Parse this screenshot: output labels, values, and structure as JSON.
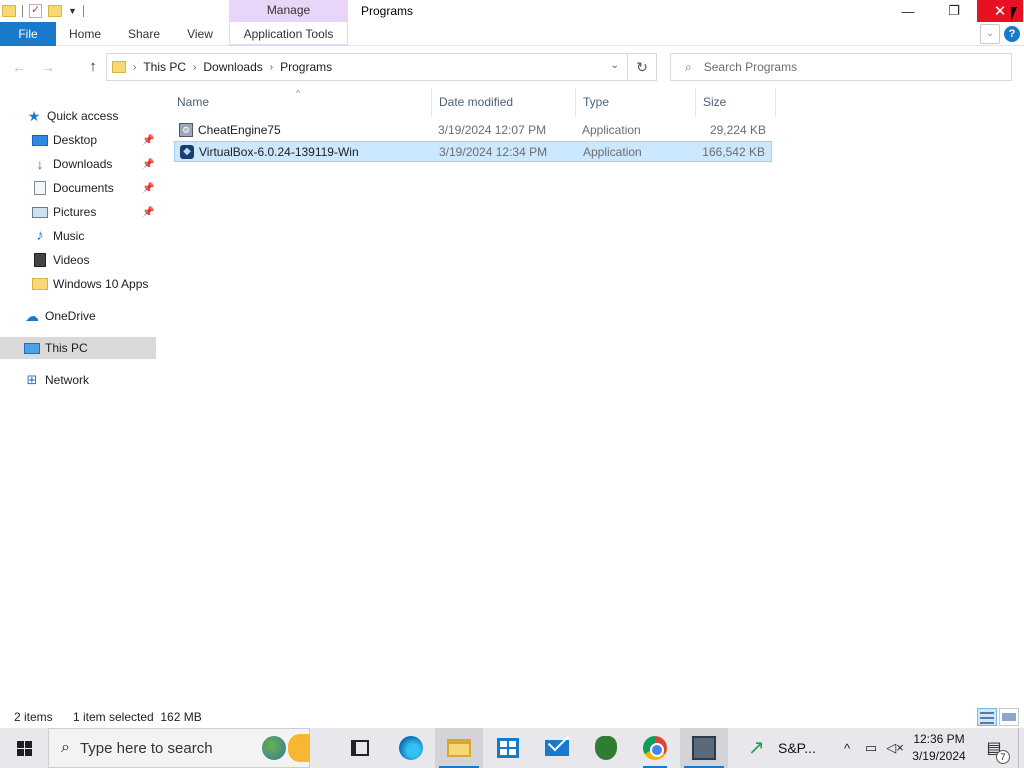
{
  "titlebar": {
    "manage_label": "Manage",
    "window_title": "Programs",
    "minimize_glyph": "—",
    "restore_glyph": "❐",
    "close_glyph": "✕"
  },
  "ribbon": {
    "tabs": [
      {
        "label": "File"
      },
      {
        "label": "Home"
      },
      {
        "label": "Share"
      },
      {
        "label": "View"
      },
      {
        "label": "Application Tools"
      }
    ],
    "help_glyph": "?"
  },
  "address": {
    "crumbs": [
      "This PC",
      "Downloads",
      "Programs"
    ],
    "search_placeholder": "Search Programs"
  },
  "nav_pane": {
    "items": [
      {
        "label": "Quick access",
        "icon": "star-icon"
      },
      {
        "label": "Desktop",
        "icon": "desktop-icon",
        "pinned": true
      },
      {
        "label": "Downloads",
        "icon": "download-icon",
        "pinned": true
      },
      {
        "label": "Documents",
        "icon": "document-icon",
        "pinned": true
      },
      {
        "label": "Pictures",
        "icon": "pictures-icon",
        "pinned": true
      },
      {
        "label": "Music",
        "icon": "music-icon"
      },
      {
        "label": "Videos",
        "icon": "videos-icon"
      },
      {
        "label": "Windows 10 Apps",
        "icon": "folder-icon"
      },
      {
        "label": "OneDrive",
        "icon": "cloud-icon"
      },
      {
        "label": "This PC",
        "icon": "computer-icon",
        "selected": true
      },
      {
        "label": "Network",
        "icon": "network-icon"
      }
    ]
  },
  "files": {
    "columns": [
      "Name",
      "Date modified",
      "Type",
      "Size"
    ],
    "rows": [
      {
        "name": "CheatEngine75",
        "date": "3/19/2024 12:07 PM",
        "type": "Application",
        "size": "29,224 KB",
        "icon": "cheatengine-icon",
        "selected": false
      },
      {
        "name": "VirtualBox-6.0.24-139119-Win",
        "date": "3/19/2024 12:34 PM",
        "type": "Application",
        "size": "166,542 KB",
        "icon": "virtualbox-icon",
        "selected": true
      }
    ]
  },
  "status": {
    "item_count": "2 items",
    "selection": "1 item selected  162 MB"
  },
  "taskbar": {
    "search_placeholder": "Type here to search",
    "sp_label": "S&P...",
    "clock_time": "12:36 PM",
    "clock_date": "3/19/2024",
    "notification_count": "7"
  },
  "colors": {
    "accent": "#1979ca",
    "manage_tab": "#e9d5f7",
    "close_button": "#e81123",
    "selection": "#cce8ff"
  }
}
